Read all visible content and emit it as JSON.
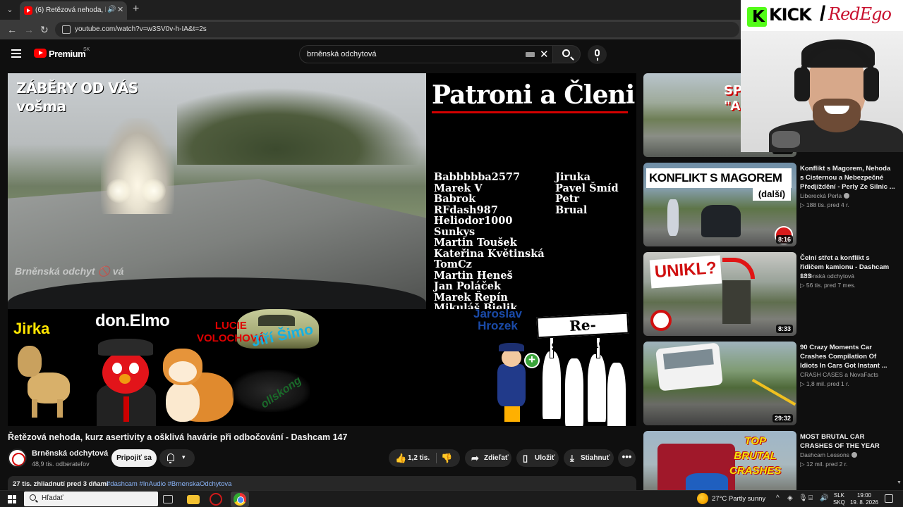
{
  "browser": {
    "tab_title": "(6) Řetězová nehoda, kurz a",
    "new_tab": "+",
    "url": "youtube.com/watch?v=w3SV0v-h-IA&t=2s"
  },
  "youtube": {
    "logo_text": "Premium",
    "region": "SK",
    "search_query": "brněnská odchytová"
  },
  "video_frame": {
    "overlay_top_left": "ZÁBĚRY OD VÁS\nvošma",
    "watermark": "Brněnská odchyt 🚫 vá",
    "patrons_title": "Patroni a Členi",
    "names_left": "Babbbbba2577\nMarek V\nBabrok\nRFdash987\nHeliodor1000\nSunkys\nMartin Toušek\nKateřina Květinská\nTomCz\nMartin Heneš\nJan Poláček\nMarek Řepín\nMikuláš Bielik",
    "names_right": "Jiruka\nPavel Šmíd\nPetr\nBrual",
    "label_jirka": "Jirka",
    "label_elmo": "don.Elmo",
    "label_lucie": "LUCIE\nVOLOCHOVÁ",
    "label_jiri": "Jiří Šimo",
    "label_ollskong": "ollskong",
    "label_jaroslav": "Jaroslav\nHrozek",
    "label_resistance": "Re-sistance"
  },
  "video": {
    "title": "Řetězová nehoda, kurz asertivity a ošklivá havárie při odbočování - Dashcam 147",
    "channel": "Brněnská odchytová",
    "subscribers": "48,9 tis. odberateľov",
    "subscribe_label": "Pripojiť sa",
    "likes": "1,2 tis.",
    "share_label": "Zdieľať",
    "save_label": "Uložiť",
    "download_label": "Stiahnuť",
    "more_label": "•••",
    "views_date": "27 tis. zhliadnutí  pred 3 dňami",
    "hashtags": "#dashcam #InAudio #BrnenskaOdchytova"
  },
  "related": [
    {
      "title": "",
      "channel": "",
      "meta": "",
      "duration": "10:07",
      "thumb_text": "SPLA\n\"AU"
    },
    {
      "title": "Konflikt s Magorem, Nehoda s Cisternou a Nebezpečné Předjíždění - Perly Ze Silnic ...",
      "channel": "Liberecká Perla",
      "meta": "188 tis.  pred 4 r.",
      "duration": "8:16",
      "thumb_text": "KONFLIKT S MAGOREM",
      "thumb_sub": "(další)"
    },
    {
      "title": "Čelní střet a konflikt s řidičem kamionu - Dashcam 133",
      "channel": "Brněnská odchytová",
      "meta": "56 tis.  pred 7 mes.",
      "duration": "8:33",
      "thumb_text": "UNIKL?"
    },
    {
      "title": "90 Crazy Moments Car Crashes Compilation Of Idiots In Cars Got Instant ...",
      "channel": "CRASH CASES a NovaFacts",
      "meta": "1,8 mil.  pred 1 r.",
      "duration": "29:32"
    },
    {
      "title": "MOST BRUTAL CAR CRASHES OF THE YEAR",
      "channel": "Dashcam Lessons",
      "meta": "12 mil.  pred 2 r.",
      "duration": "",
      "thumb_text": "TOP\nBRUTAL\nCRASHES"
    }
  ],
  "webcam": {
    "brand_left": "KICK",
    "brand_slash": "/",
    "brand_right": "RedEgo"
  },
  "taskbar": {
    "search_placeholder": "Hľadať",
    "weather": "27°C  Partly sunny",
    "lang_top": "SLK",
    "lang_bottom": "SKQ",
    "time": "19:00",
    "date": "19. 8. 2026"
  },
  "colors": {
    "youtube_red": "#ff0000",
    "kick_green": "#53fc18",
    "redego_red": "#c8102e",
    "link_blue": "#8ab4f8"
  }
}
